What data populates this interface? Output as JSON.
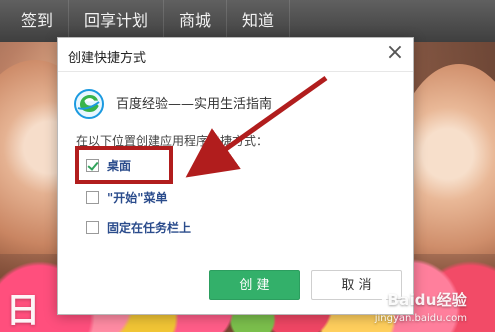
{
  "top_nav": {
    "items": [
      {
        "label": "签到"
      },
      {
        "label": "回享计划"
      },
      {
        "label": "商城"
      },
      {
        "label": "知道"
      }
    ]
  },
  "dialog": {
    "title": "创建快捷方式",
    "app_name": "百度经验——实用生活指南",
    "instruction": "在以下位置创建应用程序快捷方式：",
    "options": [
      {
        "label": "桌面",
        "checked": true
      },
      {
        "label": "\"开始\"菜单",
        "checked": false
      },
      {
        "label": "固定在任务栏上",
        "checked": false
      }
    ],
    "create_label": "创 建",
    "cancel_label": "取 消"
  },
  "background": {
    "corner_text": "日"
  },
  "watermark": {
    "main": "Baidu经验",
    "sub": "jingyan.baidu.com"
  },
  "colors": {
    "accent_green": "#33b06a",
    "highlight_red": "#b11d1d",
    "nav_dark": "#4a4a4a"
  }
}
